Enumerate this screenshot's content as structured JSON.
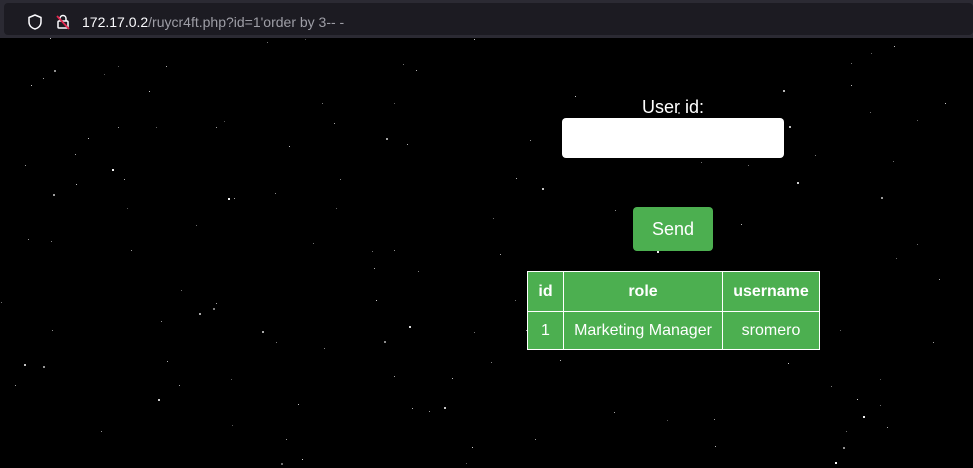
{
  "browser": {
    "url_host": "172.17.0.2",
    "url_path": "/ruycr4ft.php?id=1'order by 3-- -"
  },
  "form": {
    "label": "User id:",
    "input_value": "",
    "send_label": "Send"
  },
  "results": {
    "columns": [
      "id",
      "role",
      "username"
    ],
    "rows": [
      [
        "1",
        "Marketing Manager",
        "sromero"
      ]
    ]
  },
  "colors": {
    "accent": "#4caf50",
    "background": "#000000",
    "urlbar": "#1c1b22"
  },
  "icons": {
    "tracking": "shield-icon",
    "security": "insecure-lock-icon"
  }
}
